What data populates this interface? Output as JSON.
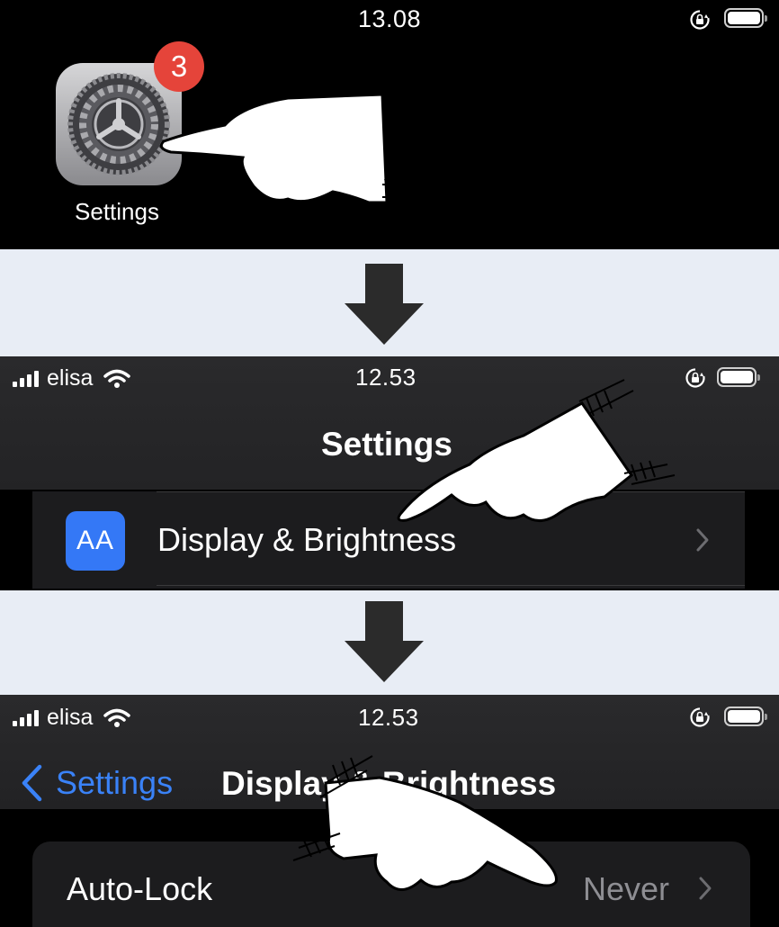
{
  "screen1": {
    "time": "13.08",
    "app_label": "Settings",
    "badge_count": "3",
    "icon": "settings-gear-icon"
  },
  "screen2": {
    "carrier": "elisa",
    "time": "12.53",
    "title": "Settings",
    "row": {
      "label": "Display & Brightness",
      "icon_text": "AA",
      "icon": "display-brightness-icon"
    }
  },
  "screen3": {
    "carrier": "elisa",
    "time": "12.53",
    "back_label": "Settings",
    "title": "Display & Brightness",
    "row": {
      "label": "Auto-Lock",
      "value": "Never"
    }
  },
  "colors": {
    "accent_blue": "#3a82f7",
    "badge_red": "#e5443a",
    "background": "#e8edf5",
    "row_bg": "#1c1c1e"
  }
}
